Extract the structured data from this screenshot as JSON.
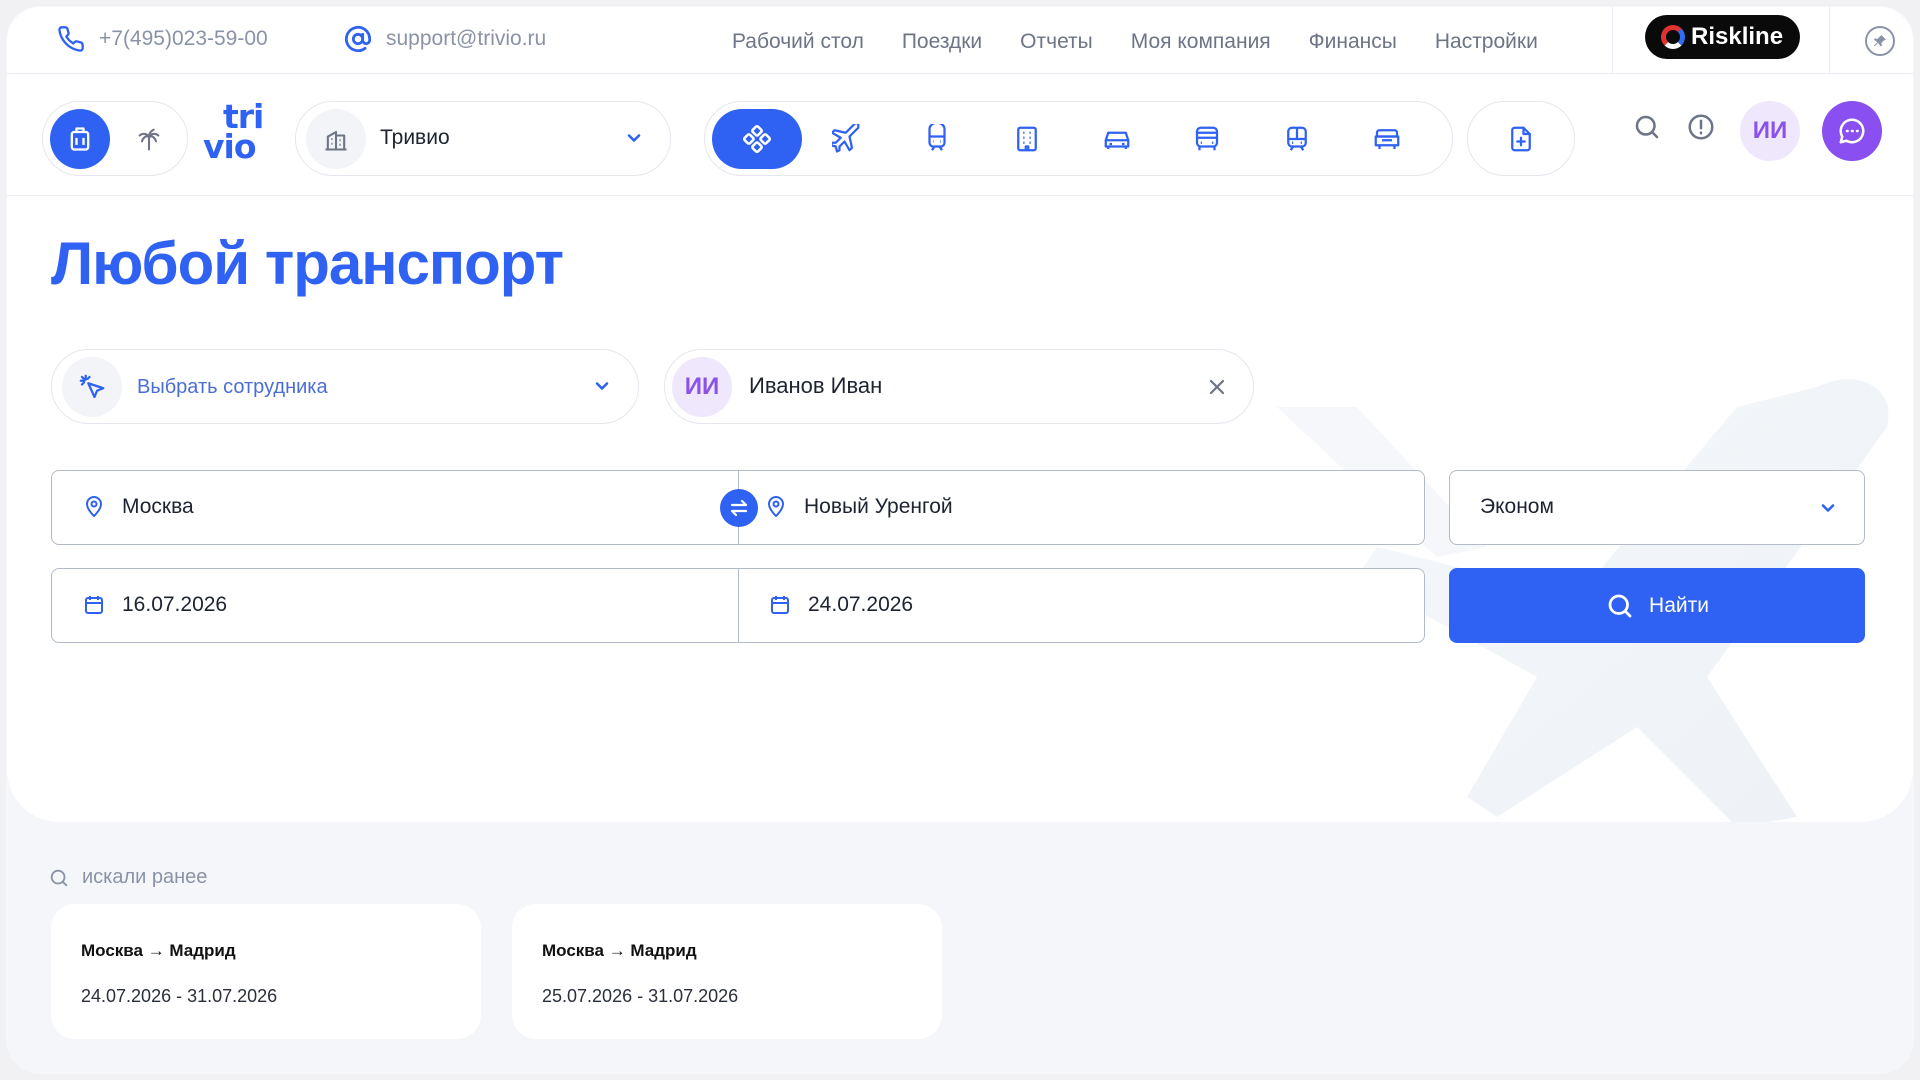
{
  "topbar": {
    "phone": "+7(495)023-59-00",
    "email": "support@trivio.ru",
    "nav": [
      "Рабочий стол",
      "Поездки",
      "Отчеты",
      "Моя компания",
      "Финансы",
      "Настройки"
    ],
    "riskline_label": "Riskline"
  },
  "header": {
    "logo_line1": "tri",
    "logo_line2": "vio",
    "company": "Тривио",
    "user_initials": "ИИ",
    "transport_modes": [
      "any-transport-icon",
      "plane-icon",
      "train-icon",
      "hotel-icon",
      "car-icon",
      "bus-icon",
      "tram-icon",
      "transfer-icon"
    ]
  },
  "main": {
    "title": "Любой транспорт",
    "employee_placeholder": "Выбрать сотрудника",
    "employee_initials": "ИИ",
    "employee_name": "Иванов Иван",
    "from": "Москва",
    "to": "Новый Уренгой",
    "class": "Эконом",
    "date_from": "16.07.2026",
    "date_to": "24.07.2026",
    "search_label": "Найти"
  },
  "recent": {
    "label": "искали ранее",
    "items": [
      {
        "route": "Москва → Мадрид",
        "dates": "24.07.2026 - 31.07.2026"
      },
      {
        "route": "Москва → Мадрид",
        "dates": "25.07.2026 - 31.07.2026"
      }
    ]
  },
  "colors": {
    "accent": "#2f62f2",
    "purple": "#8a4ff0",
    "avatar_bg": "#efe7fb"
  }
}
